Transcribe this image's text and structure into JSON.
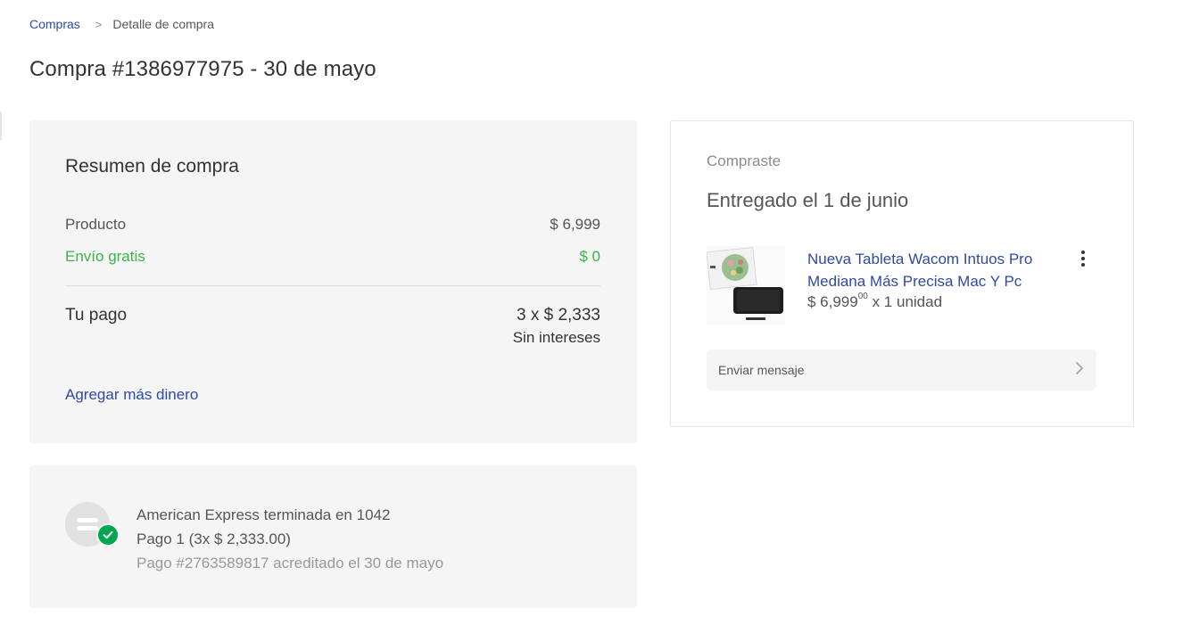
{
  "breadcrumb": {
    "parent": "Compras",
    "separator": ">",
    "current": "Detalle de compra"
  },
  "page_title": "Compra #1386977975 - 30 de mayo",
  "summary": {
    "title": "Resumen de compra",
    "product_label": "Producto",
    "product_value": "$ 6,999",
    "shipping_label": "Envío gratis",
    "shipping_value": "$ 0",
    "payment_label": "Tu pago",
    "payment_amount": "3 x $ 2,333",
    "payment_note": "Sin intereses",
    "add_money_link": "Agregar más dinero"
  },
  "payment_method": {
    "card": "American Express terminada en 1042",
    "installment": "Pago 1 (3x $ 2,333.00)",
    "status": "Pago #2763589817 acreditado el 30 de mayo",
    "icon": "credit-card-icon",
    "status_icon": "check-circle-icon"
  },
  "purchase": {
    "label": "Compraste",
    "status": "Entregado el 1 de junio",
    "item_title": "Nueva Tableta Wacom Intuos Pro Mediana Más Precisa Mac Y Pc",
    "item_price": "$ 6,999",
    "item_price_cents": "00",
    "item_quantity": " x 1 unidad",
    "message_button": "Enviar mensaje"
  },
  "colors": {
    "link": "#2f4aa6",
    "success": "#39b54a",
    "check": "#00a650",
    "card_bg": "#f5f5f5"
  }
}
